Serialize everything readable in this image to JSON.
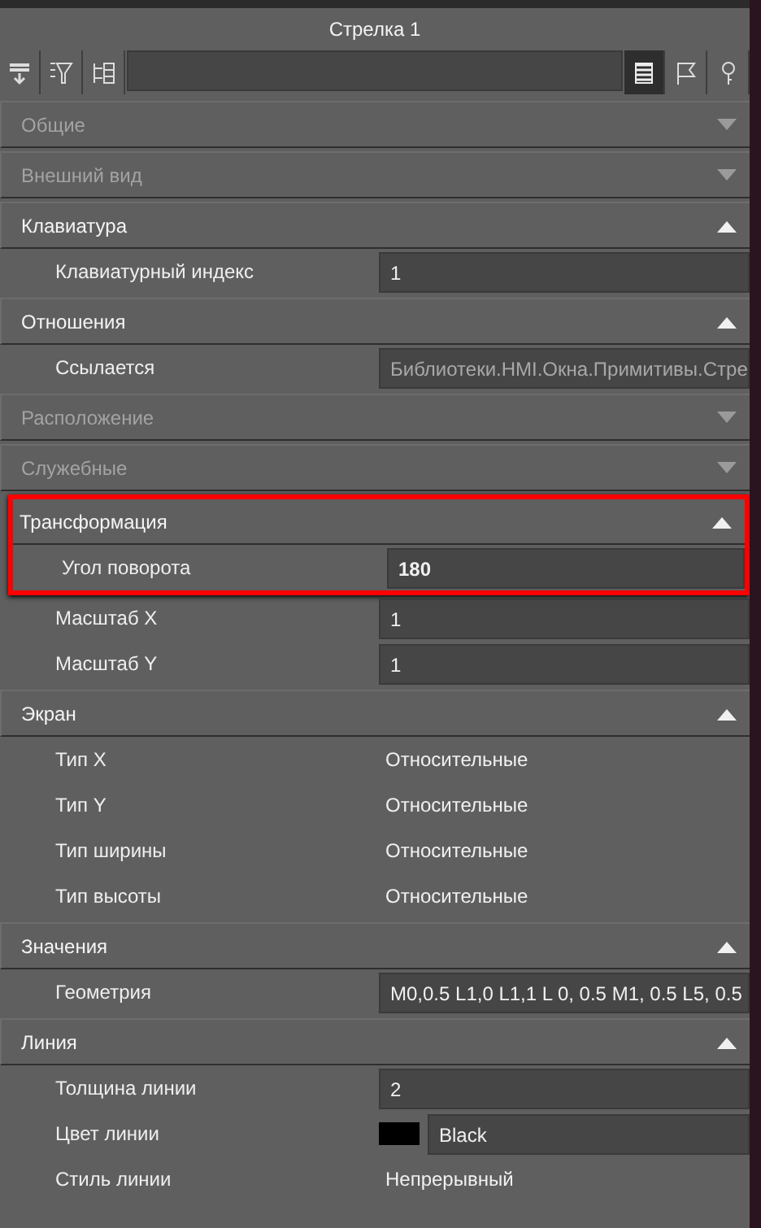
{
  "window": {
    "title": "Стрелка 1"
  },
  "toolbar": {
    "left_buttons": [
      {
        "kind": "sort"
      },
      {
        "kind": "filter"
      },
      {
        "kind": "tree"
      }
    ],
    "view_buttons": [
      {
        "kind": "list",
        "selected": true
      },
      {
        "kind": "flag",
        "selected": false
      },
      {
        "kind": "key",
        "selected": false
      }
    ]
  },
  "sections": [
    {
      "title": "Общие",
      "expanded": false,
      "highlighted": false
    },
    {
      "title": "Внешний вид",
      "expanded": false,
      "highlighted": false
    },
    {
      "title": "Клавиатура",
      "expanded": true,
      "highlighted": false,
      "properties": [
        {
          "label": "Клавиатурный индекс",
          "kind": "field",
          "value": "1",
          "changed": false
        }
      ]
    },
    {
      "title": "Отношения",
      "expanded": true,
      "highlighted": false,
      "properties": [
        {
          "label": "Ссылается",
          "kind": "readonly",
          "value": "Библиотеки.HMI.Окна.Примитивы.Стре",
          "changed": false
        }
      ]
    },
    {
      "title": "Расположение",
      "expanded": false,
      "highlighted": false
    },
    {
      "title": "Служебные",
      "expanded": false,
      "highlighted": false
    },
    {
      "title": "Трансформация",
      "expanded": true,
      "highlighted": true,
      "properties": [
        {
          "label": "Угол поворота",
          "kind": "field",
          "value": "180",
          "changed": true
        },
        {
          "label": "Масштаб X",
          "kind": "field",
          "value": "1",
          "changed": false
        },
        {
          "label": "Масштаб Y",
          "kind": "field",
          "value": "1",
          "changed": false
        }
      ]
    },
    {
      "title": "Экран",
      "expanded": true,
      "highlighted": false,
      "properties": [
        {
          "label": "Тип X",
          "kind": "text",
          "value": "Относительные",
          "changed": false
        },
        {
          "label": "Тип Y",
          "kind": "text",
          "value": "Относительные",
          "changed": false
        },
        {
          "label": "Тип ширины",
          "kind": "text",
          "value": "Относительные",
          "changed": false
        },
        {
          "label": "Тип высоты",
          "kind": "text",
          "value": "Относительные",
          "changed": false
        }
      ]
    },
    {
      "title": "Значения",
      "expanded": true,
      "highlighted": false,
      "properties": [
        {
          "label": "Геометрия",
          "kind": "field",
          "value": "M0,0.5 L1,0 L1,1 L 0, 0.5 M1, 0.5 L5, 0.5",
          "changed": false
        }
      ]
    },
    {
      "title": "Линия",
      "expanded": true,
      "highlighted": false,
      "properties": [
        {
          "label": "Толщина линии",
          "kind": "field",
          "value": "2",
          "changed": false
        },
        {
          "label": "Цвет линии",
          "kind": "color",
          "value": "Black",
          "color": "#000000",
          "changed": false
        },
        {
          "label": "Стиль линии",
          "kind": "text",
          "value": "Непрерывный",
          "changed": false
        }
      ]
    }
  ]
}
